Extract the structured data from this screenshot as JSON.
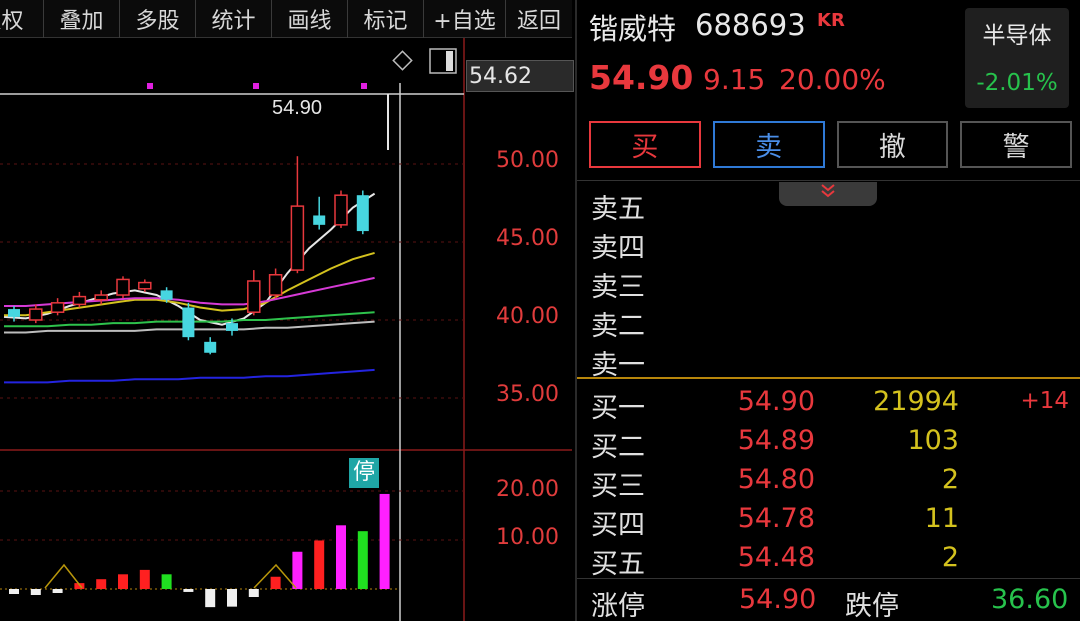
{
  "toolbar": {
    "items": [
      {
        "id": "fuquan",
        "label": "复权"
      },
      {
        "id": "diejia",
        "label": "叠加"
      },
      {
        "id": "duogu",
        "label": "多股"
      },
      {
        "id": "tongji",
        "label": "统计"
      },
      {
        "id": "huaxian",
        "label": "画线"
      },
      {
        "id": "biaoji",
        "label": "标记"
      },
      {
        "id": "zixuan",
        "label": "+自选"
      },
      {
        "id": "fanhui",
        "label": "返回"
      }
    ]
  },
  "chart": {
    "crosshair_price": "54.62",
    "limit_price_label": "54.90",
    "price_axis": [
      "50.00",
      "45.00",
      "40.00",
      "35.00"
    ],
    "volume_axis": [
      "20.00",
      "10.00"
    ],
    "stop_badge": "停",
    "icons": [
      "diamond-icon",
      "panel-toggle-icon"
    ]
  },
  "chart_data": {
    "type": "candlestick",
    "ylim": [
      33.0,
      55.5
    ],
    "y_ticks": [
      50.0,
      45.0,
      40.0,
      35.0
    ],
    "candles": [
      {
        "o": 40.7,
        "c": 40.2,
        "h": 40.9,
        "l": 39.9,
        "up": false
      },
      {
        "o": 40.0,
        "c": 40.7,
        "h": 41.0,
        "l": 39.8,
        "up": true
      },
      {
        "o": 40.5,
        "c": 41.1,
        "h": 41.4,
        "l": 40.3,
        "up": true
      },
      {
        "o": 41.0,
        "c": 41.5,
        "h": 41.8,
        "l": 40.8,
        "up": true
      },
      {
        "o": 41.3,
        "c": 41.6,
        "h": 41.9,
        "l": 41.0,
        "up": true
      },
      {
        "o": 41.6,
        "c": 42.6,
        "h": 42.8,
        "l": 41.4,
        "up": true
      },
      {
        "o": 42.0,
        "c": 42.4,
        "h": 42.6,
        "l": 41.8,
        "up": true
      },
      {
        "o": 41.9,
        "c": 41.3,
        "h": 42.1,
        "l": 41.1,
        "up": false
      },
      {
        "o": 40.8,
        "c": 38.9,
        "h": 41.1,
        "l": 38.7,
        "up": false
      },
      {
        "o": 38.6,
        "c": 37.9,
        "h": 38.9,
        "l": 37.8,
        "up": false
      },
      {
        "o": 39.8,
        "c": 39.3,
        "h": 40.1,
        "l": 39.0,
        "up": false
      },
      {
        "o": 40.5,
        "c": 42.5,
        "h": 43.2,
        "l": 40.3,
        "up": true
      },
      {
        "o": 41.6,
        "c": 42.9,
        "h": 43.3,
        "l": 41.4,
        "up": true
      },
      {
        "o": 43.2,
        "c": 47.3,
        "h": 50.5,
        "l": 43.0,
        "up": true
      },
      {
        "o": 46.7,
        "c": 46.1,
        "h": 47.9,
        "l": 45.8,
        "up": false
      },
      {
        "o": 46.1,
        "c": 48.0,
        "h": 48.3,
        "l": 45.9,
        "up": true
      },
      {
        "o": 48.0,
        "c": 45.7,
        "h": 48.3,
        "l": 45.5,
        "up": false
      }
    ],
    "ma": [
      {
        "name": "ma_white",
        "color": "#e6e6e6",
        "values": [
          40.2,
          40.1,
          40.4,
          40.9,
          41.3,
          41.7,
          41.9,
          41.6,
          40.9,
          40.0,
          39.7,
          40.1,
          41.1,
          43.0,
          44.6,
          45.8,
          47.2,
          48.1
        ]
      },
      {
        "name": "ma_yellow",
        "color": "#d4c21e",
        "values": [
          40.3,
          40.3,
          40.5,
          40.7,
          40.9,
          41.1,
          41.3,
          41.3,
          41.1,
          40.8,
          40.6,
          40.7,
          41.1,
          41.9,
          42.6,
          43.3,
          43.9,
          44.3
        ]
      },
      {
        "name": "ma_magenta",
        "color": "#d63ad6",
        "values": [
          40.9,
          40.9,
          41.0,
          41.1,
          41.2,
          41.3,
          41.4,
          41.4,
          41.3,
          41.1,
          41.0,
          41.0,
          41.2,
          41.5,
          41.8,
          42.1,
          42.4,
          42.7
        ]
      },
      {
        "name": "ma_green",
        "color": "#2ec24c",
        "values": [
          39.6,
          39.6,
          39.6,
          39.7,
          39.7,
          39.8,
          39.8,
          39.9,
          39.9,
          39.9,
          39.9,
          40.0,
          40.0,
          40.1,
          40.2,
          40.3,
          40.4,
          40.5
        ]
      },
      {
        "name": "ma_gray",
        "color": "#bdbdbd",
        "values": [
          39.2,
          39.2,
          39.3,
          39.3,
          39.3,
          39.3,
          39.3,
          39.4,
          39.4,
          39.4,
          39.4,
          39.4,
          39.5,
          39.5,
          39.6,
          39.7,
          39.8,
          39.9
        ]
      },
      {
        "name": "ma_blue",
        "color": "#2424e0",
        "values": [
          36.0,
          36.0,
          36.0,
          36.1,
          36.1,
          36.1,
          36.2,
          36.2,
          36.2,
          36.3,
          36.3,
          36.3,
          36.4,
          36.4,
          36.5,
          36.6,
          36.7,
          36.8
        ]
      }
    ],
    "volume": {
      "ylim": [
        0,
        25.0
      ],
      "y_ticks": [
        20.0,
        10.0
      ],
      "bars": [
        {
          "v": 0.5,
          "kind": "down"
        },
        {
          "v": 0.6,
          "kind": "down"
        },
        {
          "v": 0.4,
          "kind": "down"
        },
        {
          "v": 1.2,
          "kind": "up"
        },
        {
          "v": 2.0,
          "kind": "up"
        },
        {
          "v": 3.0,
          "kind": "up"
        },
        {
          "v": 3.9,
          "kind": "up"
        },
        {
          "v": 3.0,
          "kind": "green"
        },
        {
          "v": 0.6,
          "kind": "down"
        },
        {
          "v": 3.7,
          "kind": "down"
        },
        {
          "v": 3.6,
          "kind": "down"
        },
        {
          "v": 0.8,
          "kind": "down"
        },
        {
          "v": 2.5,
          "kind": "up"
        },
        {
          "v": 7.6,
          "kind": "magenta"
        },
        {
          "v": 9.9,
          "kind": "up"
        },
        {
          "v": 13.0,
          "kind": "magenta"
        },
        {
          "v": 11.8,
          "kind": "green"
        },
        {
          "v": 19.4,
          "kind": "magenta"
        }
      ]
    }
  },
  "stock": {
    "name": "锴威特",
    "code": "688693",
    "badge": "KR",
    "price": "54.90",
    "change": "9.15",
    "change_pct": "20.00%"
  },
  "sector": {
    "name": "半导体",
    "change": "-2.01%"
  },
  "actions": {
    "buy": "买",
    "sell": "卖",
    "cancel": "撤",
    "alert": "警"
  },
  "collapse_icon": "chevron-double-down-icon",
  "order_book": {
    "asks": [
      {
        "label": "卖五"
      },
      {
        "label": "卖四"
      },
      {
        "label": "卖三"
      },
      {
        "label": "卖二"
      },
      {
        "label": "卖一"
      }
    ],
    "bids": [
      {
        "label": "买一",
        "price": "54.90",
        "volume": "21994",
        "delta": "+14"
      },
      {
        "label": "买二",
        "price": "54.89",
        "volume": "103",
        "delta": ""
      },
      {
        "label": "买三",
        "price": "54.80",
        "volume": "2",
        "delta": ""
      },
      {
        "label": "买四",
        "price": "54.78",
        "volume": "11",
        "delta": ""
      },
      {
        "label": "买五",
        "price": "54.48",
        "volume": "2",
        "delta": ""
      }
    ]
  },
  "limits": {
    "up_label": "涨停",
    "up_value": "54.90",
    "down_label": "跌停",
    "down_value": "36.60"
  }
}
